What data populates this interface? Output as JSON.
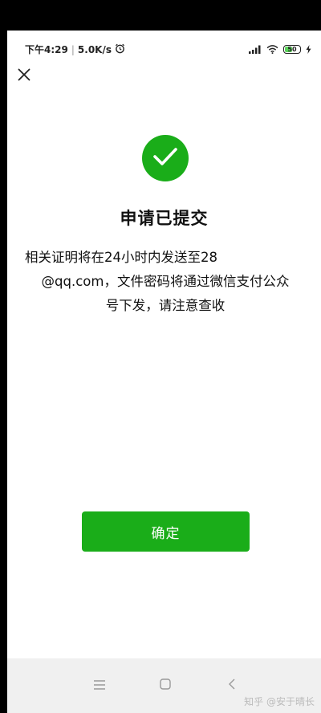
{
  "status_bar": {
    "time": "下午4:29",
    "net_speed": "5.0K/s",
    "battery": "50"
  },
  "icons": {
    "close": "close-icon",
    "success": "checkmark-icon",
    "alarm": "alarm-icon",
    "signal": "signal-icon",
    "wifi": "wifi-icon",
    "battery": "battery-icon",
    "charging": "charging-icon",
    "menu": "menu-icon",
    "home": "home-icon",
    "back": "back-icon"
  },
  "colors": {
    "accent": "#1aad19",
    "text": "#111111",
    "nav_bg": "#f0f0f0"
  },
  "result": {
    "title": "申请已提交",
    "message_line1": "相关证明将在24小时内发送至28",
    "message_line2": "@qq.com，文件密码将通过微信支付公众",
    "message_line3": "号下发，请注意查收"
  },
  "actions": {
    "confirm_label": "确定"
  },
  "watermark": "知乎 @安于晴长"
}
